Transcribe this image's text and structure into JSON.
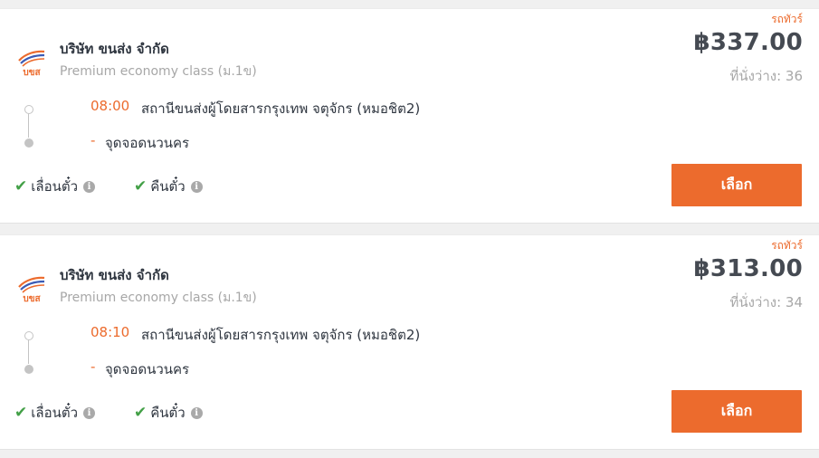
{
  "colors": {
    "accent": "#ec6b2d",
    "check": "#43a047",
    "text": "#2f3640",
    "muted": "#a7a7a7"
  },
  "trips": [
    {
      "bus_type": "รถทัวร์",
      "company": "บริษัท ขนส่ง จำกัด",
      "bus_class": "Premium economy class (ม.1ข)",
      "price": "฿337.00",
      "seats": "ที่นั่งว่าง: 36",
      "departure_time": "08:00",
      "departure_station": "สถานีขนส่งผู้โดยสารกรุงเทพ จตุจักร (หมอชิต2)",
      "arrival_dash": "-",
      "arrival_station": "จุดจอดนวนคร",
      "policy_change": "เลื่อนตั๋ว",
      "policy_refund": "คืนตั๋ว",
      "select_label": "เลือก"
    },
    {
      "bus_type": "รถทัวร์",
      "company": "บริษัท ขนส่ง จำกัด",
      "bus_class": "Premium economy class (ม.1ข)",
      "price": "฿313.00",
      "seats": "ที่นั่งว่าง: 34",
      "departure_time": "08:10",
      "departure_station": "สถานีขนส่งผู้โดยสารกรุงเทพ จตุจักร (หมอชิต2)",
      "arrival_dash": "-",
      "arrival_station": "จุดจอดนวนคร",
      "policy_change": "เลื่อนตั๋ว",
      "policy_refund": "คืนตั๋ว",
      "select_label": "เลือก"
    }
  ],
  "icons": {
    "check": "check-icon",
    "info": "info-icon",
    "logo": "transport-company-logo"
  },
  "logo_text": "บขส"
}
